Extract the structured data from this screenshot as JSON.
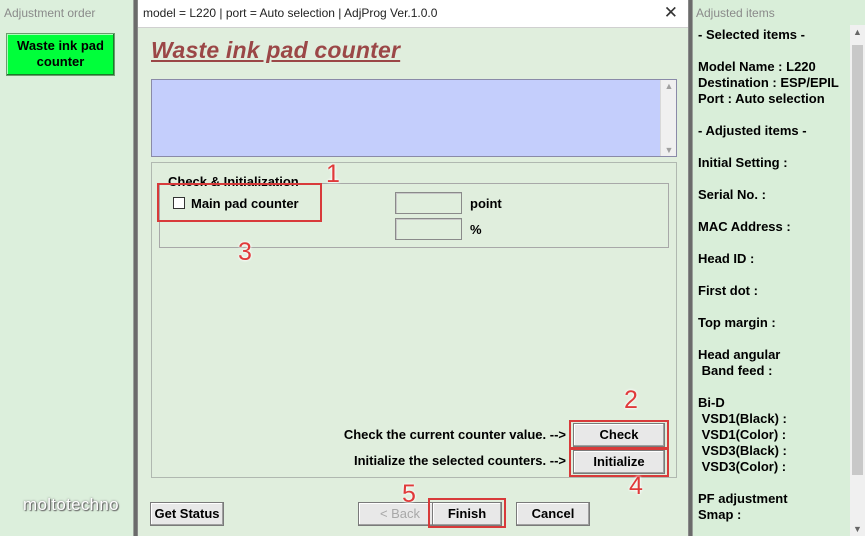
{
  "left_panel": {
    "title": "Adjustment order",
    "button_label": "Waste ink pad counter",
    "watermark": "moltotechno"
  },
  "dialog": {
    "title": "model = L220 | port = Auto selection | AdjProg Ver.1.0.0",
    "close_glyph": "✕",
    "heading": "Waste ink pad counter",
    "group_label": "Check & Initialization",
    "checkbox_label": "Main pad counter",
    "unit_point": "point",
    "unit_percent": "%",
    "check_text": "Check the current counter value. -->",
    "check_button": "Check",
    "init_text": "Initialize the selected counters. -->",
    "init_button": "Initialize",
    "get_status_button": "Get Status",
    "back_button": "< Back",
    "finish_button": "Finish",
    "cancel_button": "Cancel"
  },
  "annotations": {
    "n1": "1",
    "n2": "2",
    "n3": "3",
    "n4": "4",
    "n5": "5",
    "color": "#e03a3a"
  },
  "right_panel": {
    "title": "Adjusted items",
    "lines": [
      "- Selected items -",
      "Model Name : L220",
      "Destination : ESP/EPIL",
      "Port : Auto selection",
      "- Adjusted items -",
      "Initial Setting :",
      "Serial No. :",
      "MAC Address :",
      "Head ID :",
      "First dot :",
      "Top margin :",
      "Head angular",
      " Band feed :",
      "Bi-D",
      " VSD1(Black) :",
      " VSD1(Color) :",
      " VSD3(Black) :",
      " VSD3(Color) :",
      "PF adjustment",
      "Smap :"
    ]
  },
  "colors": {
    "left_button": "#00ff3a",
    "heading": "#9b4747",
    "display_box": "#c4cefc",
    "panel_bg": "#e0eedd"
  }
}
